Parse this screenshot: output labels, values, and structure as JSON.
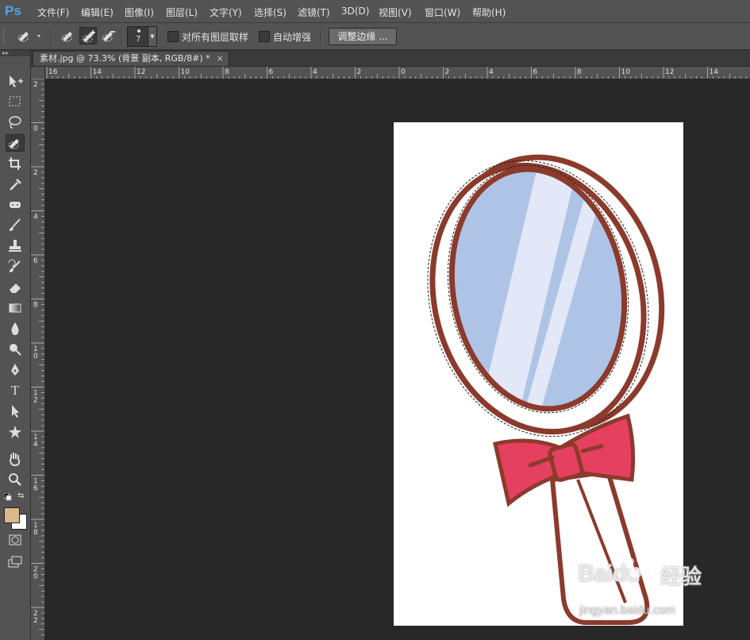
{
  "app": {
    "logo": "Ps"
  },
  "menu": [
    "文件(F)",
    "编辑(E)",
    "图像(I)",
    "图层(L)",
    "文字(Y)",
    "选择(S)",
    "滤镜(T)",
    "3D(D)",
    "视图(V)",
    "窗口(W)",
    "帮助(H)"
  ],
  "options": {
    "brush_size": "7",
    "sample_all_layers_label": "对所有图层取样",
    "sample_all_layers_checked": false,
    "auto_enhance_label": "自动增强",
    "auto_enhance_checked": false,
    "refine_edge_label": "调整边缘 ..."
  },
  "toolbar": {
    "collapse_glyph": "▸▸",
    "tools": [
      "move-tool-icon",
      "marquee-tool-icon",
      "lasso-tool-icon",
      "quick-selection-tool-icon",
      "crop-tool-icon",
      "eyedropper-tool-icon",
      "spot-healing-tool-icon",
      "brush-tool-icon",
      "clone-stamp-tool-icon",
      "history-brush-tool-icon",
      "eraser-tool-icon",
      "gradient-tool-icon",
      "blur-tool-icon",
      "dodge-tool-icon",
      "pen-tool-icon",
      "type-tool-icon",
      "path-selection-tool-icon",
      "custom-shape-tool-icon",
      "hand-tool-icon",
      "zoom-tool-icon"
    ],
    "active_tool": "quick-selection-tool-icon",
    "type_tool_glyph": "T",
    "foreground_color": "#d9b88a",
    "background_color": "#ffffff"
  },
  "document": {
    "tab_title": "素材.jpg @ 73.3% (背景 副本, RGB/8#) *",
    "tab_close": "×"
  },
  "rulers": {
    "horizontal": [
      "16",
      "14",
      "12",
      "10",
      "8",
      "6",
      "4",
      "2",
      "0",
      "2",
      "4",
      "6",
      "8",
      "10",
      "12",
      "14"
    ],
    "vertical": [
      "2",
      "0",
      "2",
      "4",
      "6",
      "8",
      "1\n0",
      "1\n2",
      "1\n4",
      "1\n6",
      "1\n8",
      "2\n0",
      "2\n2"
    ]
  },
  "colors": {
    "frame": "#8b3a2c",
    "mirror_glass": "#aec4e6",
    "glass_highlight": "#e2e8f7",
    "bow": "#e5405f"
  },
  "watermark": {
    "brand": "Baidu",
    "product": "经验",
    "url": "jingyan.baidu.com"
  }
}
